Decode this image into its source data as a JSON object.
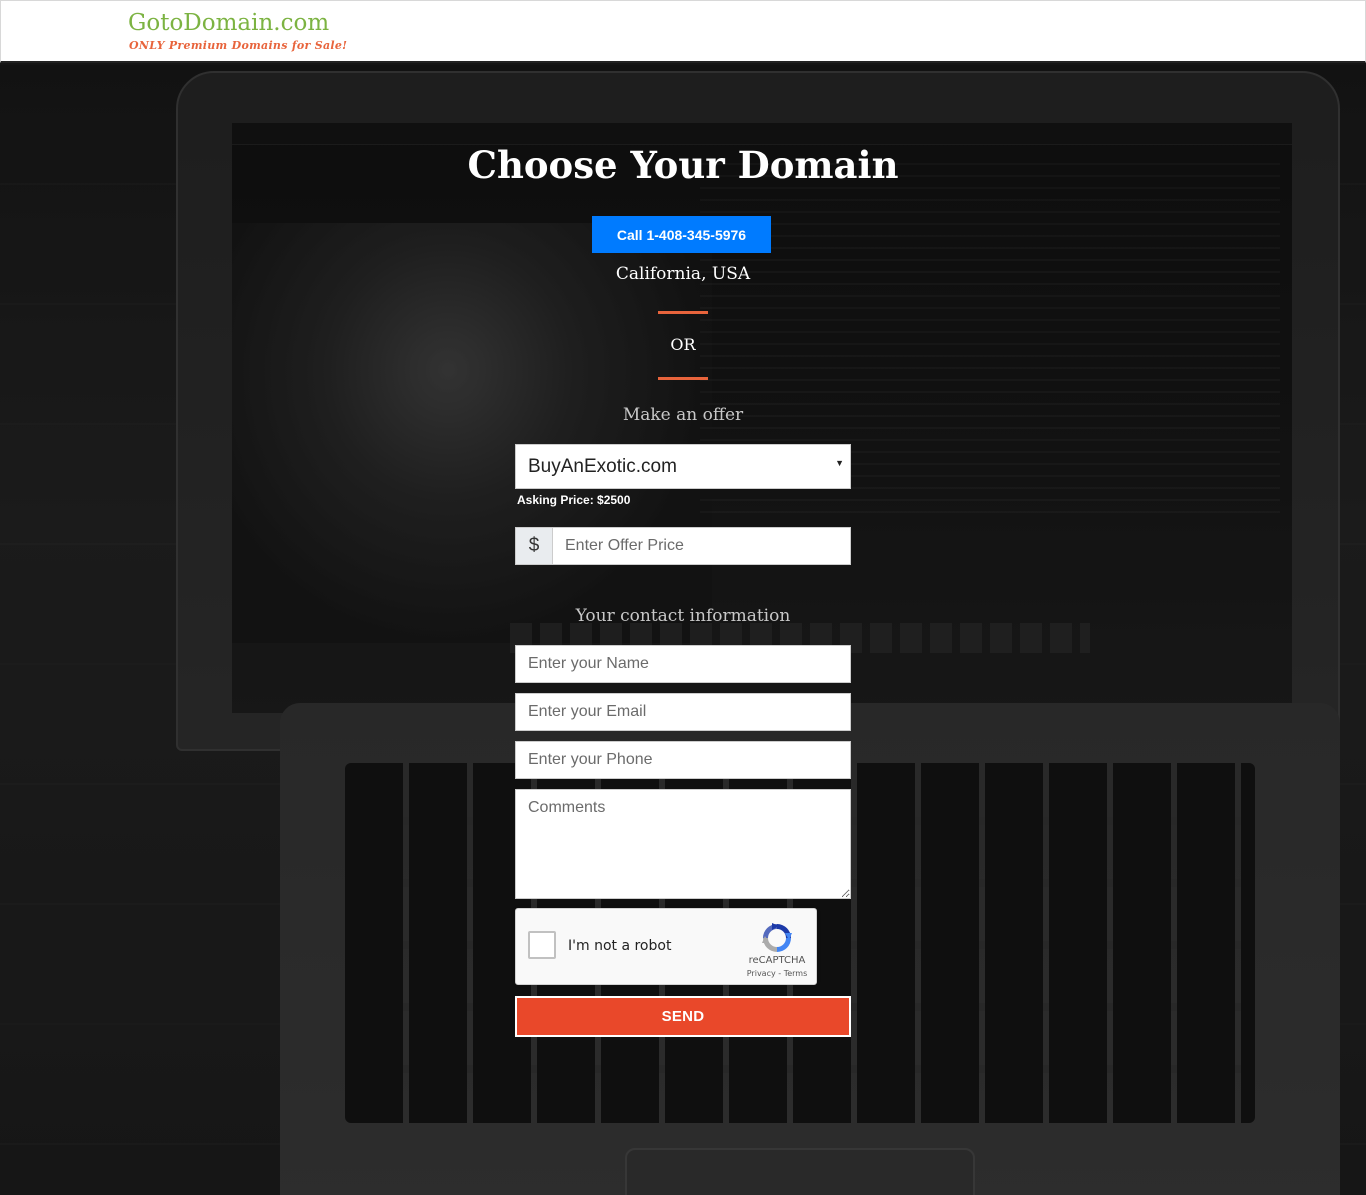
{
  "header": {
    "logo_title": "GotoDomain.com",
    "logo_tagline": "ONLY Premium Domains for Sale!"
  },
  "main": {
    "title": "Choose Your Domain",
    "call_button": "Call 1-408-345-5976",
    "location": "California, USA",
    "or_text": "OR",
    "offer_heading": "Make an offer",
    "domain_select": {
      "selected": "BuyAnExotic.com",
      "arrow": "▼"
    },
    "asking_price": "Asking Price: $2500",
    "offer": {
      "prefix": "$",
      "placeholder": "Enter Offer Price"
    },
    "contact_heading": "Your contact information",
    "fields": {
      "name_placeholder": "Enter your Name",
      "email_placeholder": "Enter your Email",
      "phone_placeholder": "Enter your Phone",
      "comments_placeholder": "Comments"
    },
    "recaptcha": {
      "label": "I'm not a robot",
      "brand": "reCAPTCHA",
      "links": "Privacy - Terms"
    },
    "send_button": "SEND"
  },
  "colors": {
    "logo_green": "#7cb342",
    "accent_orange": "#e8643c",
    "call_blue": "#007bff",
    "send_red": "#e9482a"
  }
}
